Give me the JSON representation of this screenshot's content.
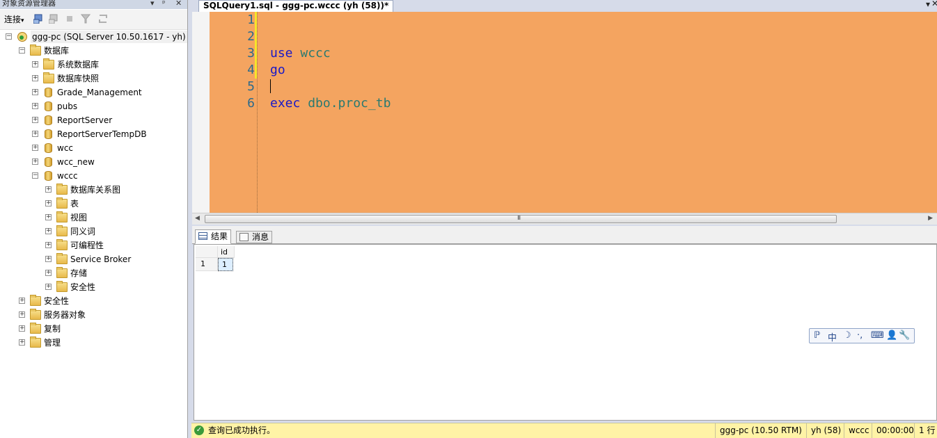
{
  "object_explorer": {
    "title": "对象资源管理器",
    "title_controls": [
      "▾",
      "ᵖ",
      "✕"
    ],
    "toolbar": {
      "connect_label": "连接",
      "connect_arrow": "▾"
    },
    "tree": [
      {
        "label": "ggg-pc (SQL Server 10.50.1617 - yh)",
        "icon": "server-icon",
        "expanded": true
      },
      {
        "label": "数据库",
        "icon": "folder-icon",
        "expanded": true
      },
      {
        "label": "系统数据库",
        "icon": "folder-icon",
        "expanded": false
      },
      {
        "label": "数据库快照",
        "icon": "folder-icon",
        "expanded": false
      },
      {
        "label": "Grade_Management",
        "icon": "database-icon",
        "expanded": false
      },
      {
        "label": "pubs",
        "icon": "database-icon",
        "expanded": false
      },
      {
        "label": "ReportServer",
        "icon": "database-icon",
        "expanded": false
      },
      {
        "label": "ReportServerTempDB",
        "icon": "database-icon",
        "expanded": false
      },
      {
        "label": "wcc",
        "icon": "database-icon",
        "expanded": false
      },
      {
        "label": "wcc_new",
        "icon": "database-icon",
        "expanded": false
      },
      {
        "label": "wccc",
        "icon": "database-icon",
        "expanded": true
      },
      {
        "label": "数据库关系图",
        "icon": "folder-icon",
        "expanded": false
      },
      {
        "label": "表",
        "icon": "folder-icon",
        "expanded": false
      },
      {
        "label": "视图",
        "icon": "folder-icon",
        "expanded": false
      },
      {
        "label": "同义词",
        "icon": "folder-icon",
        "expanded": false
      },
      {
        "label": "可编程性",
        "icon": "folder-icon",
        "expanded": false
      },
      {
        "label": "Service Broker",
        "icon": "folder-icon",
        "expanded": false
      },
      {
        "label": "存储",
        "icon": "folder-icon",
        "expanded": false
      },
      {
        "label": "安全性",
        "icon": "folder-icon",
        "expanded": false
      },
      {
        "label": "安全性",
        "icon": "folder-icon",
        "expanded": false
      },
      {
        "label": "服务器对象",
        "icon": "folder-icon",
        "expanded": false
      },
      {
        "label": "复制",
        "icon": "folder-icon",
        "expanded": false
      },
      {
        "label": "管理",
        "icon": "folder-icon",
        "expanded": false
      }
    ]
  },
  "editor": {
    "tab_title": "SQLQuery1.sql - ggg-pc.wccc (yh (58))*",
    "tab_dropdown": "▾",
    "tab_close": "✕",
    "line_numbers": [
      "1",
      "2",
      "3",
      "4",
      "5",
      "6"
    ],
    "lines": [
      {
        "kw": "",
        "rest": ""
      },
      {
        "kw": "",
        "rest": ""
      },
      {
        "kw": "use",
        "rest": " wccc"
      },
      {
        "kw": "go",
        "rest": ""
      },
      {
        "kw": "",
        "rest": ""
      },
      {
        "kw": "exec",
        "rest": " dbo.proc_tb"
      }
    ],
    "background_color": "#f4a460",
    "scroll_grip": "III"
  },
  "results": {
    "tabs": [
      "结果",
      "消息"
    ],
    "columns": [
      "id"
    ],
    "rows": [
      {
        "row_number": "1",
        "values": [
          "1"
        ]
      }
    ]
  },
  "ime_toolbar": [
    "ℙ",
    "中",
    "☽",
    "·,",
    "⌨",
    "👤",
    "🔧"
  ],
  "status_bar": {
    "message": "查询已成功执行。",
    "server": "ggg-pc (10.50 RTM)",
    "user": "yh (58)",
    "database": "wccc",
    "elapsed": "00:00:00",
    "rows": "1 行"
  }
}
